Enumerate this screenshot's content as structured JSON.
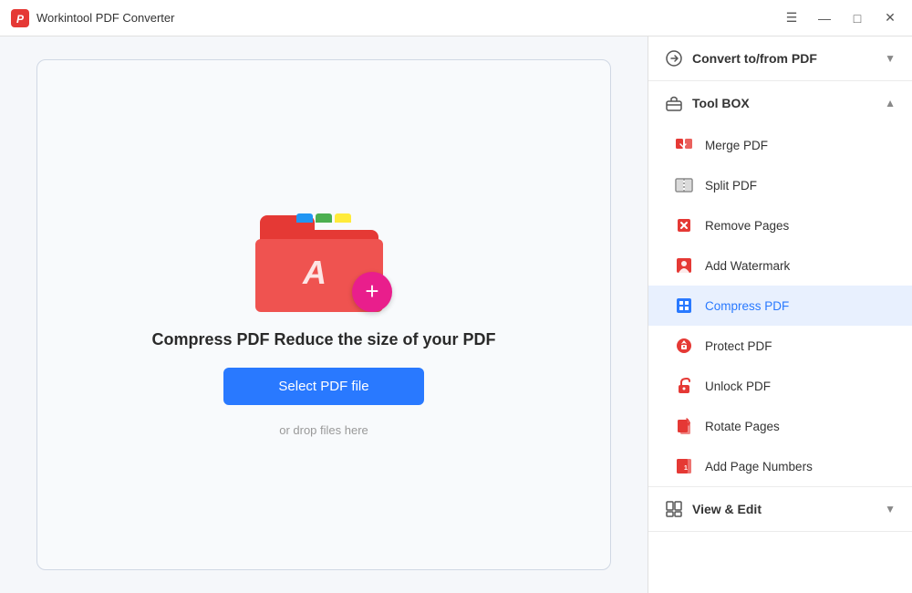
{
  "titleBar": {
    "appTitle": "Workintool PDF Converter",
    "controls": {
      "menu": "☰",
      "minimize": "—",
      "maximize": "□",
      "close": "✕"
    }
  },
  "dropZone": {
    "mainText": "Compress PDF Reduce the size of your PDF",
    "selectButton": "Select PDF file",
    "dropText": "or drop files here"
  },
  "sidebar": {
    "sections": [
      {
        "id": "convert",
        "title": "Convert to/from PDF",
        "icon": "⟳",
        "expanded": false,
        "items": []
      },
      {
        "id": "toolbox",
        "title": "Tool BOX",
        "icon": "🧰",
        "expanded": true,
        "items": [
          {
            "id": "merge",
            "label": "Merge PDF",
            "active": false
          },
          {
            "id": "split",
            "label": "Split PDF",
            "active": false
          },
          {
            "id": "remove",
            "label": "Remove Pages",
            "active": false
          },
          {
            "id": "watermark",
            "label": "Add Watermark",
            "active": false
          },
          {
            "id": "compress",
            "label": "Compress PDF",
            "active": true
          },
          {
            "id": "protect",
            "label": "Protect PDF",
            "active": false
          },
          {
            "id": "unlock",
            "label": "Unlock PDF",
            "active": false
          },
          {
            "id": "rotate",
            "label": "Rotate Pages",
            "active": false
          },
          {
            "id": "pagenumbers",
            "label": "Add Page Numbers",
            "active": false
          }
        ]
      },
      {
        "id": "viewedit",
        "title": "View & Edit",
        "icon": "📄",
        "expanded": false,
        "items": []
      }
    ]
  }
}
